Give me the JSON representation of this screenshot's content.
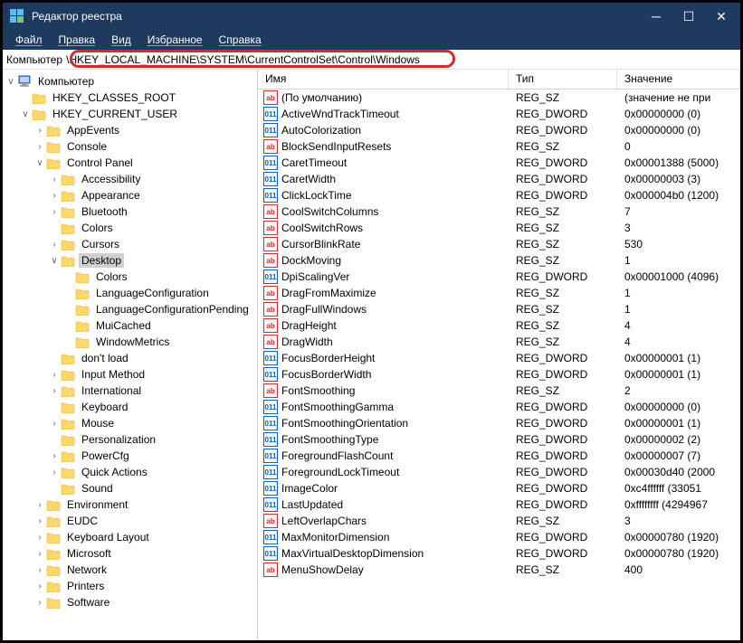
{
  "window": {
    "title": "Редактор реестра"
  },
  "menu": {
    "file": "Файл",
    "edit": "Правка",
    "view": "Вид",
    "fav": "Избранное",
    "help": "Справка"
  },
  "address": {
    "label": "Компьютер",
    "path": "\\HKEY_LOCAL_MACHINE\\SYSTEM\\CurrentControlSet\\Control\\Windows"
  },
  "tree_root": "Компьютер",
  "tree": [
    {
      "d": 1,
      "c": "",
      "l": "HKEY_CLASSES_ROOT"
    },
    {
      "d": 1,
      "c": "v",
      "l": "HKEY_CURRENT_USER"
    },
    {
      "d": 2,
      "c": ">",
      "l": "AppEvents"
    },
    {
      "d": 2,
      "c": ">",
      "l": "Console"
    },
    {
      "d": 2,
      "c": "v",
      "l": "Control Panel"
    },
    {
      "d": 3,
      "c": ">",
      "l": "Accessibility"
    },
    {
      "d": 3,
      "c": ">",
      "l": "Appearance"
    },
    {
      "d": 3,
      "c": ">",
      "l": "Bluetooth"
    },
    {
      "d": 3,
      "c": "",
      "l": "Colors"
    },
    {
      "d": 3,
      "c": ">",
      "l": "Cursors"
    },
    {
      "d": 3,
      "c": "v",
      "l": "Desktop",
      "sel": true
    },
    {
      "d": 4,
      "c": "",
      "l": "Colors"
    },
    {
      "d": 4,
      "c": "",
      "l": "LanguageConfiguration"
    },
    {
      "d": 4,
      "c": "",
      "l": "LanguageConfigurationPending"
    },
    {
      "d": 4,
      "c": "",
      "l": "MuiCached"
    },
    {
      "d": 4,
      "c": "",
      "l": "WindowMetrics"
    },
    {
      "d": 3,
      "c": "",
      "l": "don't load"
    },
    {
      "d": 3,
      "c": ">",
      "l": "Input Method"
    },
    {
      "d": 3,
      "c": ">",
      "l": "International"
    },
    {
      "d": 3,
      "c": "",
      "l": "Keyboard"
    },
    {
      "d": 3,
      "c": ">",
      "l": "Mouse"
    },
    {
      "d": 3,
      "c": "",
      "l": "Personalization"
    },
    {
      "d": 3,
      "c": ">",
      "l": "PowerCfg"
    },
    {
      "d": 3,
      "c": ">",
      "l": "Quick Actions"
    },
    {
      "d": 3,
      "c": "",
      "l": "Sound"
    },
    {
      "d": 2,
      "c": ">",
      "l": "Environment"
    },
    {
      "d": 2,
      "c": ">",
      "l": "EUDC"
    },
    {
      "d": 2,
      "c": ">",
      "l": "Keyboard Layout"
    },
    {
      "d": 2,
      "c": ">",
      "l": "Microsoft"
    },
    {
      "d": 2,
      "c": ">",
      "l": "Network"
    },
    {
      "d": 2,
      "c": ">",
      "l": "Printers"
    },
    {
      "d": 2,
      "c": ">",
      "l": "Software"
    }
  ],
  "columns": {
    "name": "Имя",
    "type": "Тип",
    "value": "Значение"
  },
  "values": [
    {
      "t": "sz",
      "n": "(По умолчанию)",
      "ty": "REG_SZ",
      "v": "(значение не при"
    },
    {
      "t": "dw",
      "n": "ActiveWndTrackTimeout",
      "ty": "REG_DWORD",
      "v": "0x00000000 (0)"
    },
    {
      "t": "dw",
      "n": "AutoColorization",
      "ty": "REG_DWORD",
      "v": "0x00000000 (0)"
    },
    {
      "t": "sz",
      "n": "BlockSendInputResets",
      "ty": "REG_SZ",
      "v": "0"
    },
    {
      "t": "dw",
      "n": "CaretTimeout",
      "ty": "REG_DWORD",
      "v": "0x00001388 (5000)"
    },
    {
      "t": "dw",
      "n": "CaretWidth",
      "ty": "REG_DWORD",
      "v": "0x00000003 (3)"
    },
    {
      "t": "dw",
      "n": "ClickLockTime",
      "ty": "REG_DWORD",
      "v": "0x000004b0 (1200)"
    },
    {
      "t": "sz",
      "n": "CoolSwitchColumns",
      "ty": "REG_SZ",
      "v": "7"
    },
    {
      "t": "sz",
      "n": "CoolSwitchRows",
      "ty": "REG_SZ",
      "v": "3"
    },
    {
      "t": "sz",
      "n": "CursorBlinkRate",
      "ty": "REG_SZ",
      "v": "530"
    },
    {
      "t": "sz",
      "n": "DockMoving",
      "ty": "REG_SZ",
      "v": "1"
    },
    {
      "t": "dw",
      "n": "DpiScalingVer",
      "ty": "REG_DWORD",
      "v": "0x00001000 (4096)"
    },
    {
      "t": "sz",
      "n": "DragFromMaximize",
      "ty": "REG_SZ",
      "v": "1"
    },
    {
      "t": "sz",
      "n": "DragFullWindows",
      "ty": "REG_SZ",
      "v": "1"
    },
    {
      "t": "sz",
      "n": "DragHeight",
      "ty": "REG_SZ",
      "v": "4"
    },
    {
      "t": "sz",
      "n": "DragWidth",
      "ty": "REG_SZ",
      "v": "4"
    },
    {
      "t": "dw",
      "n": "FocusBorderHeight",
      "ty": "REG_DWORD",
      "v": "0x00000001 (1)"
    },
    {
      "t": "dw",
      "n": "FocusBorderWidth",
      "ty": "REG_DWORD",
      "v": "0x00000001 (1)"
    },
    {
      "t": "sz",
      "n": "FontSmoothing",
      "ty": "REG_SZ",
      "v": "2"
    },
    {
      "t": "dw",
      "n": "FontSmoothingGamma",
      "ty": "REG_DWORD",
      "v": "0x00000000 (0)"
    },
    {
      "t": "dw",
      "n": "FontSmoothingOrientation",
      "ty": "REG_DWORD",
      "v": "0x00000001 (1)"
    },
    {
      "t": "dw",
      "n": "FontSmoothingType",
      "ty": "REG_DWORD",
      "v": "0x00000002 (2)"
    },
    {
      "t": "dw",
      "n": "ForegroundFlashCount",
      "ty": "REG_DWORD",
      "v": "0x00000007 (7)"
    },
    {
      "t": "dw",
      "n": "ForegroundLockTimeout",
      "ty": "REG_DWORD",
      "v": "0x00030d40 (2000"
    },
    {
      "t": "dw",
      "n": "ImageColor",
      "ty": "REG_DWORD",
      "v": "0xc4ffffff (33051"
    },
    {
      "t": "dw",
      "n": "LastUpdated",
      "ty": "REG_DWORD",
      "v": "0xffffffff (4294967"
    },
    {
      "t": "sz",
      "n": "LeftOverlapChars",
      "ty": "REG_SZ",
      "v": "3"
    },
    {
      "t": "dw",
      "n": "MaxMonitorDimension",
      "ty": "REG_DWORD",
      "v": "0x00000780 (1920)"
    },
    {
      "t": "dw",
      "n": "MaxVirtualDesktopDimension",
      "ty": "REG_DWORD",
      "v": "0x00000780 (1920)"
    },
    {
      "t": "sz",
      "n": "MenuShowDelay",
      "ty": "REG_SZ",
      "v": "400"
    }
  ]
}
